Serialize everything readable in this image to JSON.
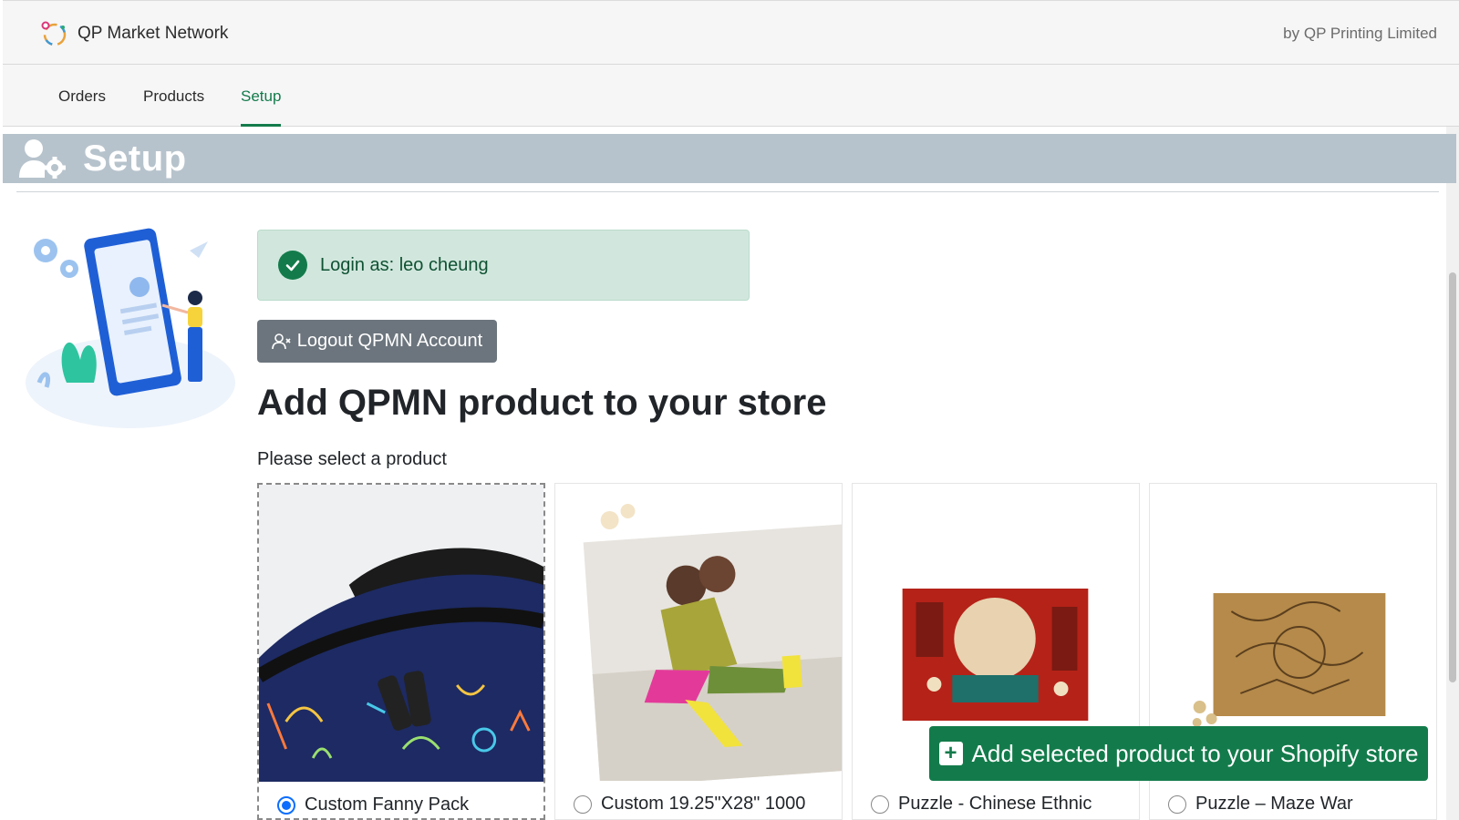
{
  "header": {
    "brand_name": "QP Market Network",
    "byline": "by QP Printing Limited"
  },
  "nav": {
    "tabs": [
      {
        "label": "Orders"
      },
      {
        "label": "Products"
      },
      {
        "label": "Setup",
        "active": true
      }
    ]
  },
  "setup": {
    "title": "Setup"
  },
  "alert": {
    "text": "Login as: leo cheung"
  },
  "logout": {
    "label": "Logout QPMN Account"
  },
  "main": {
    "heading": "Add QPMN product to your store",
    "subheading": "Please select a product"
  },
  "products": [
    {
      "label": "Custom Fanny Pack",
      "selected": true
    },
    {
      "label": "Custom 19.25\"X28\" 1000",
      "selected": false
    },
    {
      "label": "Puzzle - Chinese Ethnic",
      "selected": false
    },
    {
      "label": "Puzzle – Maze War",
      "selected": false
    }
  ],
  "add_button": {
    "label": "Add selected product to your Shopify store"
  },
  "colors": {
    "accent_green": "#137b4b",
    "banner_gray": "#b7c3cc",
    "radio_blue": "#0d6efd"
  }
}
